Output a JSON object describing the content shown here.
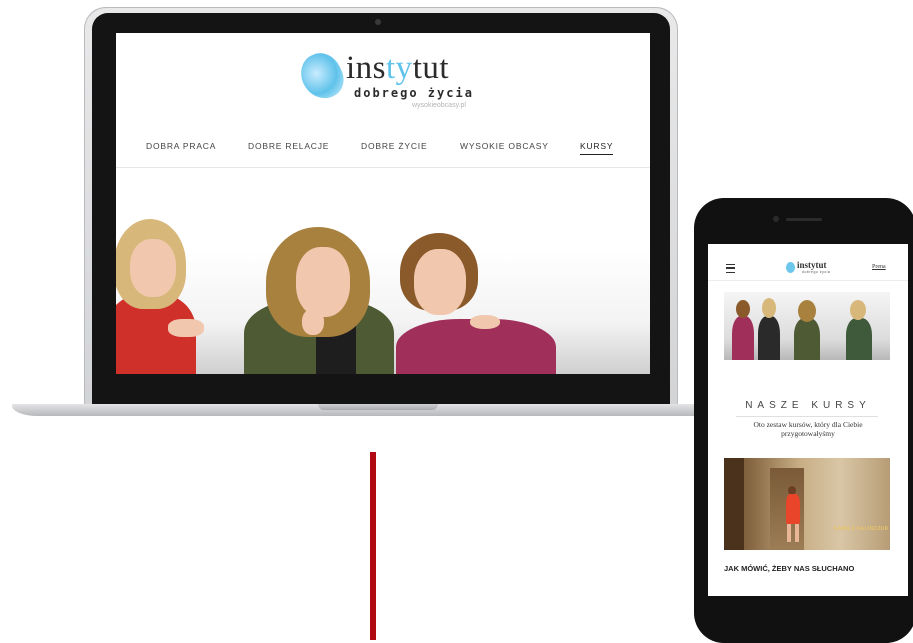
{
  "desktop": {
    "logo": {
      "word_pre": "ins",
      "word_hl": "ty",
      "word_post": "tut",
      "subtitle": "dobrego życia",
      "url": "wysokieobcasy.pl"
    },
    "nav": {
      "items": [
        "DOBRA PRACA",
        "DOBRE RELACJE",
        "DOBRE ŻYCIE",
        "WYSOKIE OBCASY"
      ],
      "active": "KURSY"
    }
  },
  "mobile": {
    "logo": {
      "word": "instytut",
      "subtitle": "dobrego życia"
    },
    "login": "Prena",
    "section_title": "NASZE KURSY",
    "section_desc": "Oto zestaw kursów, który dla Ciebie przygotowałyśmy",
    "course_caption": "KAMILA KALINCZUK",
    "course_title": "JAK MÓWIĆ, ŻEBY NAS SŁUCHANO"
  },
  "colors": {
    "accent_blue": "#5fc2ea",
    "red_bar": "#b10a13",
    "course_dress": "#e8452a"
  }
}
